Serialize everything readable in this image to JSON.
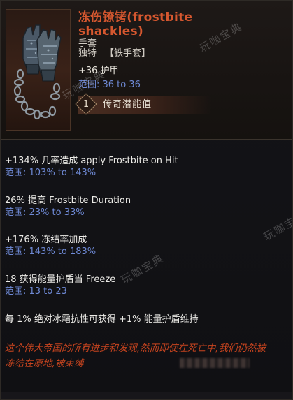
{
  "item": {
    "name": "冻伤镣铐(frostbite shackles)",
    "type": "手套",
    "rarity": "独特",
    "base_type": "【铁手套】",
    "icon": "shackled-gauntlets-icon"
  },
  "base_stat": {
    "text": "+36 护甲",
    "range": "范围: 36 to 36"
  },
  "legendary_potential": {
    "value": "1",
    "label": "传奇潜能值"
  },
  "affixes": [
    {
      "text": "+134% 几率造成 apply Frostbite on Hit",
      "range": "范围: 103% to 143%"
    },
    {
      "text": "26% 提高 Frostbite Duration",
      "range": "范围: 23% to 33%"
    },
    {
      "text": "+176% 冻结率加成",
      "range": "范围: 143% to 183%"
    },
    {
      "text": "18 获得能量护盾当 Freeze",
      "range": "范围: 13 to 23"
    },
    {
      "text": "每 1% 绝对冰霜抗性可获得 +1% 能量护盾维持",
      "range": ""
    }
  ],
  "lore": "这个伟大帝国的所有进步和发现,然而即使在死亡中,我们仍然被冻结在原地,被束缚",
  "watermark": "玩咖宝典",
  "colors": {
    "name": "#d5572f",
    "range": "#6f8ad6",
    "lore": "#c8441f",
    "text": "#ecebe7"
  }
}
